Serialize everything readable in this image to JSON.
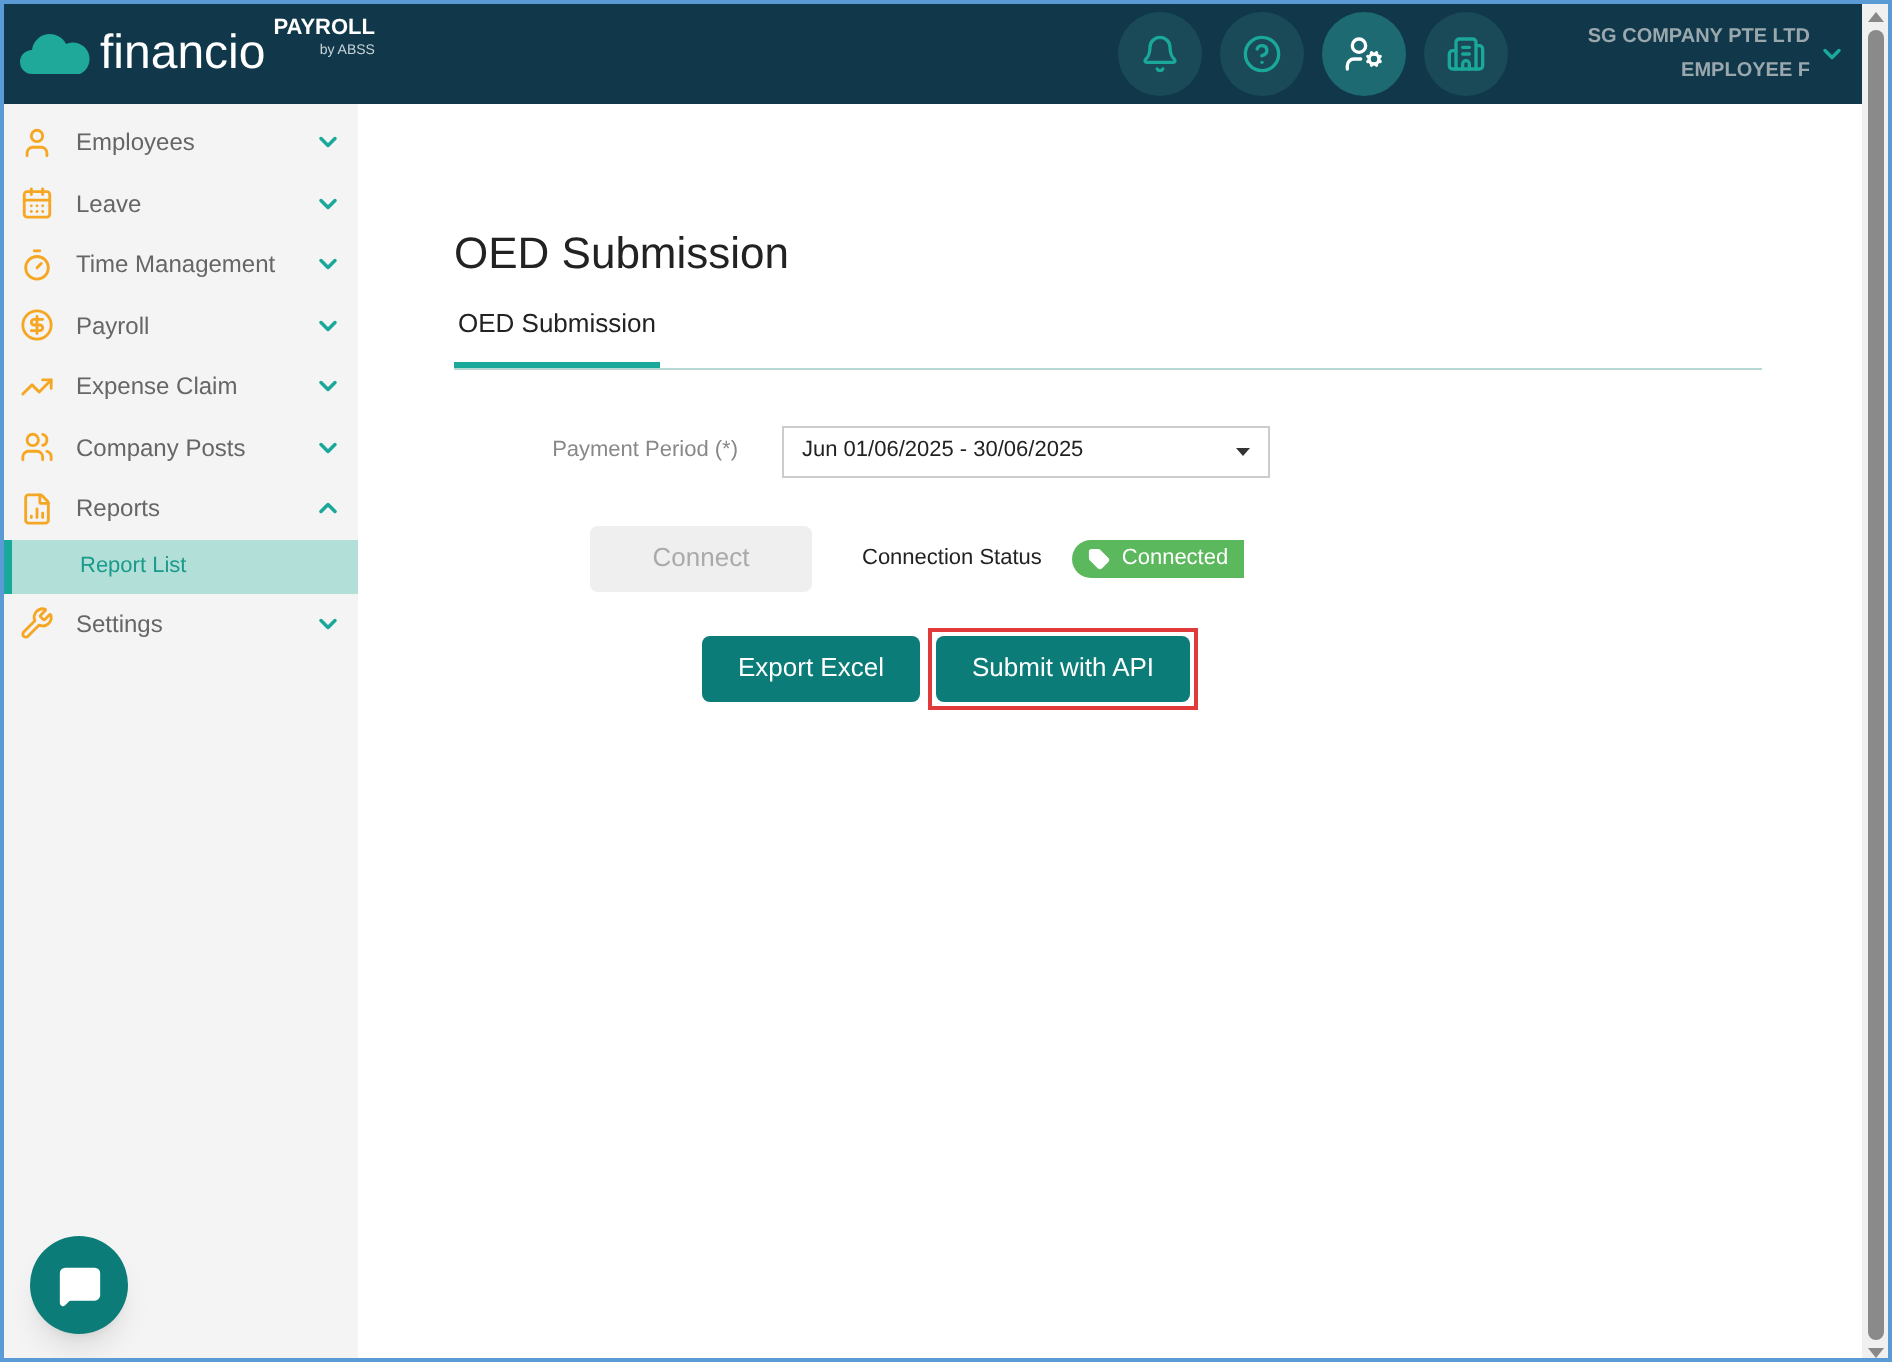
{
  "header": {
    "brand": "financio",
    "product": "PAYROLL",
    "product_by": "by ABSS",
    "icon_buttons": [
      {
        "selected": false
      },
      {
        "selected": false
      },
      {
        "selected": true
      },
      {
        "selected": false
      }
    ],
    "company": "SG COMPANY PTE LTD",
    "user": "EMPLOYEE F"
  },
  "sidebar": {
    "items": [
      {
        "label": "Employees",
        "expanded": false
      },
      {
        "label": "Leave",
        "expanded": false
      },
      {
        "label": "Time Management",
        "expanded": false
      },
      {
        "label": "Payroll",
        "expanded": false
      },
      {
        "label": "Expense Claim",
        "expanded": false
      },
      {
        "label": "Company Posts",
        "expanded": false
      },
      {
        "label": "Reports",
        "expanded": true,
        "children": [
          {
            "label": "Report List",
            "selected": true
          }
        ]
      },
      {
        "label": "Settings",
        "expanded": false
      }
    ]
  },
  "page": {
    "title": "OED Submission",
    "tabs": [
      {
        "label": "OED Submission",
        "selected": true
      }
    ],
    "payment_period": {
      "label": "Payment Period (*)",
      "value": "Jun 01/06/2025 - 30/06/2025"
    },
    "connect_button": {
      "label": "Connect",
      "disabled": true
    },
    "connection_status": {
      "label": "Connection Status",
      "badge": "Connected"
    },
    "actions": [
      {
        "label": "Export Excel",
        "highlighted": false
      },
      {
        "label": "Submit with API",
        "highlighted": true
      }
    ]
  }
}
